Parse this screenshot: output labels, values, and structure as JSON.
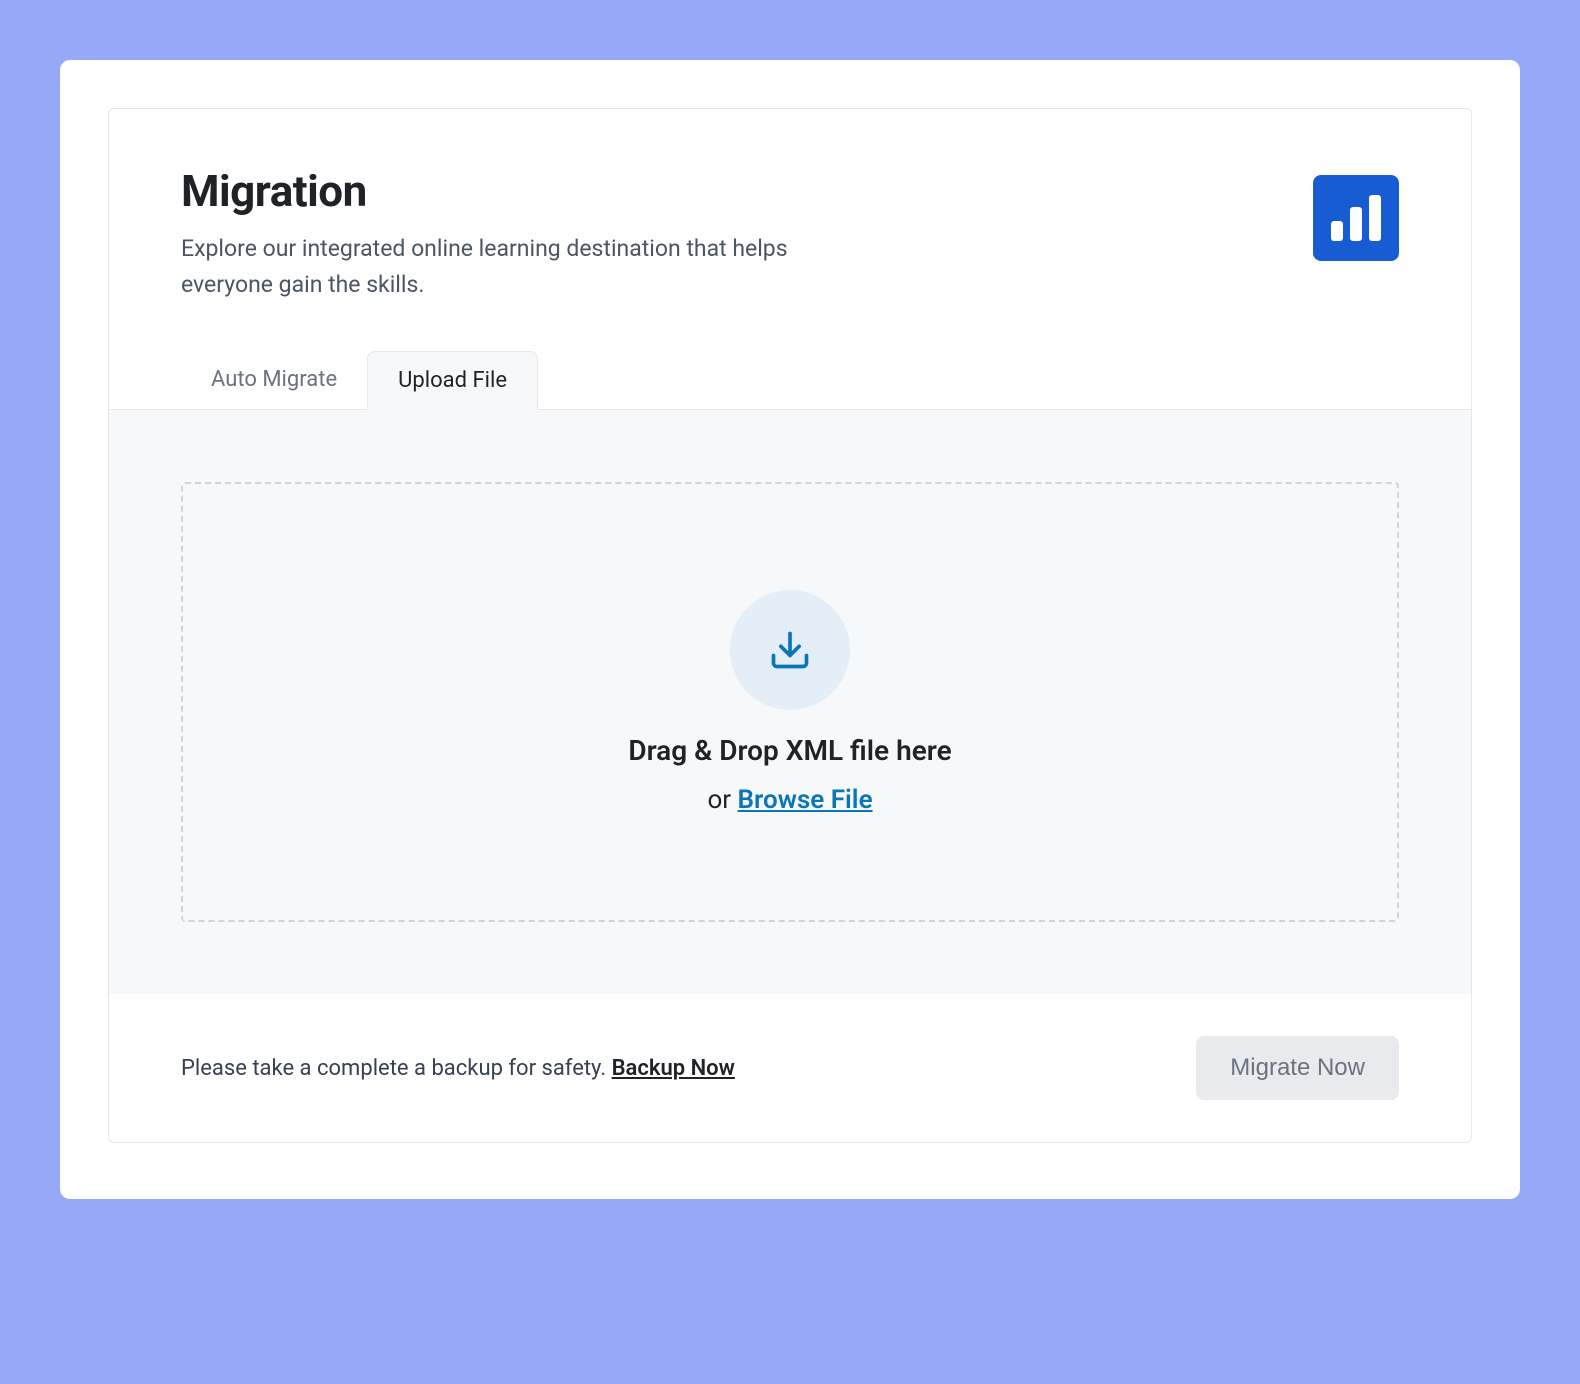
{
  "header": {
    "title": "Migration",
    "subtitle": "Explore our integrated online learning destination that helps everyone gain the skills."
  },
  "tabs": {
    "auto_migrate": "Auto Migrate",
    "upload_file": "Upload File"
  },
  "dropzone": {
    "title": "Drag & Drop XML file here",
    "or": "or",
    "browse": "Browse File"
  },
  "footer": {
    "backup_text": "Please take a complete a backup for safety.",
    "backup_link": "Backup Now",
    "migrate_button": "Migrate Now"
  }
}
